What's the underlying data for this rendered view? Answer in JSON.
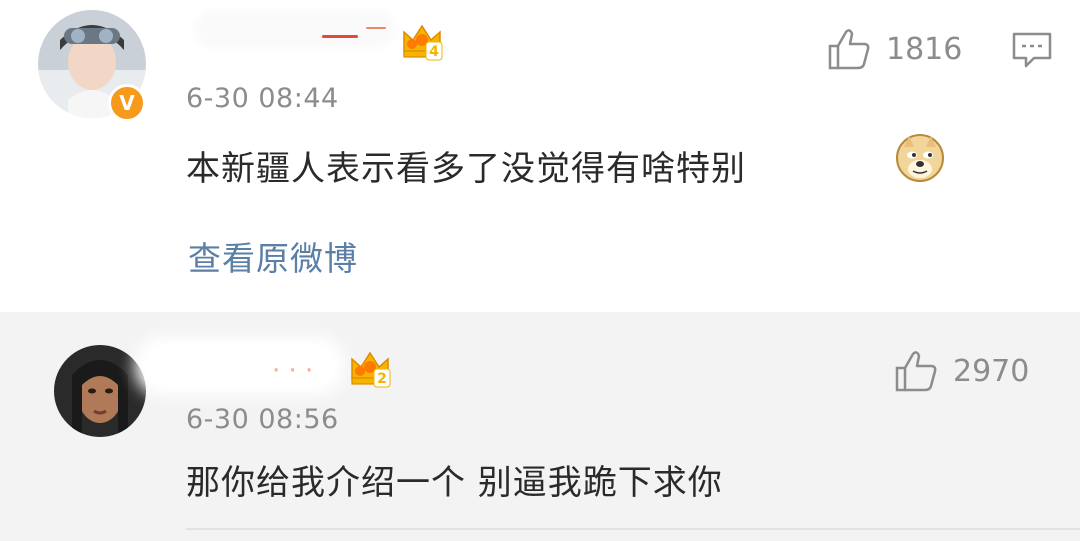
{
  "comments": [
    {
      "time": "6-30 08:44",
      "crown_level": "4",
      "verified_mark": "V",
      "text": "本新疆人表示看多了没觉得有啥特别",
      "emoji": "doge-emoji",
      "view_original": "查看原微博",
      "likes": "1816",
      "icons": [
        "avatar",
        "verified-badge",
        "crown-icon",
        "like-icon",
        "reply-icon"
      ]
    },
    {
      "time": "6-30 08:56",
      "crown_level": "2",
      "text": "那你给我介绍一个 别逼我跪下求你",
      "likes": "2970",
      "icons": [
        "avatar",
        "crown-icon",
        "like-icon"
      ]
    }
  ],
  "colors": {
    "time": "#8c8c8c",
    "text": "#2a2a2a",
    "link": "#5b7fa6",
    "crown": "#f5b400",
    "verified": "#f79a1c",
    "second_bg": "#f3f3f3"
  }
}
